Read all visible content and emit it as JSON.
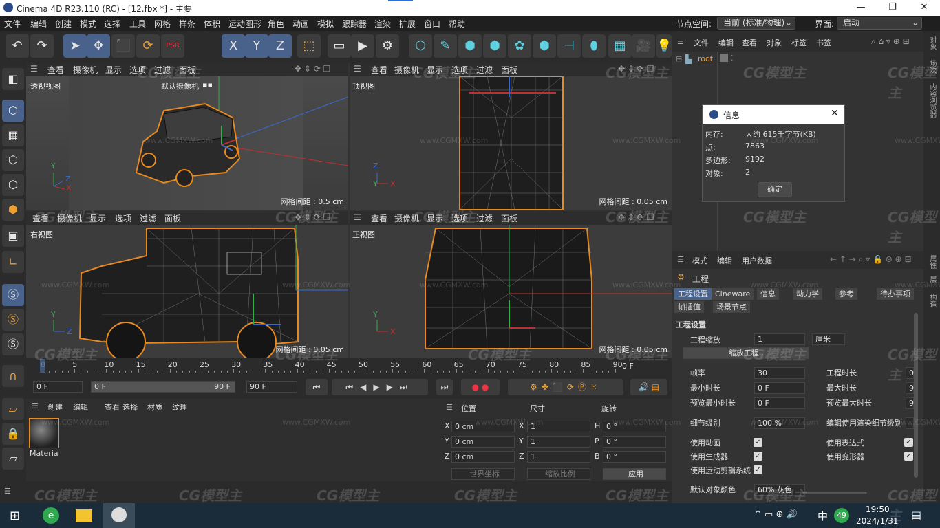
{
  "window": {
    "title": "Cinema 4D R23.110 (RC) - [12.fbx *] - 主要",
    "min": "—",
    "max": "❐",
    "close": "✕"
  },
  "menu": {
    "items": [
      "文件",
      "编辑",
      "创建",
      "模式",
      "选择",
      "工具",
      "网格",
      "样条",
      "体积",
      "运动图形",
      "角色",
      "动画",
      "模拟",
      "跟踪器",
      "渲染",
      "扩展",
      "窗口",
      "帮助"
    ],
    "node_space_label": "节点空间:",
    "node_space_value": "当前 (标准/物理)",
    "layout_label": "界面:",
    "layout_value": "启动"
  },
  "toolbar": {
    "icons": [
      "undo-icon",
      "redo-icon",
      "select-icon",
      "move-icon",
      "scale-icon",
      "rotate-icon",
      "psr-icon",
      "recent-tool-icon",
      "x-axis-icon",
      "y-axis-icon",
      "z-axis-icon",
      "coordinate-system-icon",
      "render-region-icon",
      "render-view-icon",
      "render-settings-icon",
      "cube-icon",
      "pen-icon",
      "subdivision-icon",
      "extrude-icon",
      "cloner-icon",
      "array-icon",
      "deformer-icon",
      "field-icon",
      "floor-icon",
      "camera-icon",
      "light-icon"
    ],
    "glyphs": [
      "↶",
      "↷",
      "➤",
      "✥",
      "⬛",
      "⟳",
      "PSR",
      "↺",
      "X",
      "Y",
      "Z",
      "⬚",
      "▭",
      "▶",
      "⚙",
      "⬡",
      "✎",
      "⬢",
      "⬢",
      "✿",
      "⬢",
      "⊣",
      "⬮",
      "▦",
      "🎥",
      "💡"
    ]
  },
  "viewports": [
    {
      "menu": [
        "查看",
        "摄像机",
        "显示",
        "选项",
        "过滤",
        "面板"
      ],
      "name": "透视视图",
      "camera": "默认摄像机",
      "grid": "网格间距 : 0.5 cm"
    },
    {
      "menu": [
        "查看",
        "摄像机",
        "显示",
        "选项",
        "过滤",
        "面板"
      ],
      "name": "顶视图",
      "grid": "网格间距 : 0.05 cm"
    },
    {
      "menu": [
        "查看",
        "摄像机",
        "显示",
        "选项",
        "过滤",
        "面板"
      ],
      "name": "右视图",
      "grid": "网格间距 : 0.05 cm"
    },
    {
      "menu": [
        "查看",
        "摄像机",
        "显示",
        "选项",
        "过滤",
        "面板"
      ],
      "name": "正视图",
      "grid": "网格间距 : 0.05 cm"
    }
  ],
  "axis": {
    "x": "X",
    "y": "Y",
    "z": "Z"
  },
  "timeline": {
    "ticks": [
      "0",
      "5",
      "10",
      "15",
      "20",
      "25",
      "30",
      "35",
      "40",
      "45",
      "50",
      "55",
      "60",
      "65",
      "70",
      "75",
      "80",
      "85",
      "90"
    ],
    "end_frame": "0 F",
    "current": "0 F",
    "range_start": "0 F",
    "range_end": "90 F",
    "max": "90 F"
  },
  "materials": {
    "menu": [
      "创建",
      "编辑",
      "查看",
      "选择",
      "材质",
      "纹理"
    ],
    "item": "Materia"
  },
  "coords": {
    "headers": [
      "位置",
      "尺寸",
      "旋转"
    ],
    "rows": [
      [
        "X",
        "0 cm",
        "X",
        "1",
        "H",
        "0 °"
      ],
      [
        "Y",
        "0 cm",
        "Y",
        "1",
        "P",
        "0 °"
      ],
      [
        "Z",
        "0 cm",
        "Z",
        "1",
        "B",
        "0 °"
      ]
    ],
    "world": "世界坐标",
    "scale": "缩放比例",
    "apply": "应用"
  },
  "objects": {
    "menu": [
      "文件",
      "编辑",
      "查看",
      "对象",
      "标签",
      "书签"
    ],
    "root": "root"
  },
  "info_dialog": {
    "title": "信息",
    "rows": [
      [
        "内存:",
        "大约 615千字节(KB)"
      ],
      [
        "点:",
        "7863"
      ],
      [
        "多边形:",
        "9192"
      ],
      [
        "对象:",
        "2"
      ]
    ],
    "ok": "确定",
    "close": "✕"
  },
  "attributes": {
    "menu": [
      "模式",
      "编辑",
      "用户数据"
    ],
    "title": "工程",
    "tabs": [
      "工程设置",
      "Cineware",
      "信息",
      "动力学",
      "参考",
      "待办事项"
    ],
    "tabs2": [
      "帧插值",
      "场景节点"
    ],
    "section": "工程设置",
    "scale_label": "工程缩放",
    "scale_value": "1",
    "scale_unit": "厘米",
    "scale_btn": "缩放工程...",
    "left": [
      [
        "帧率",
        "30"
      ],
      [
        "最小时长",
        "0 F"
      ],
      [
        "预览最小时长",
        "0 F"
      ],
      [
        "细节级别",
        "100 %"
      ]
    ],
    "right": [
      [
        "工程时长",
        "0"
      ],
      [
        "最大时长",
        "9"
      ],
      [
        "预览最大时长",
        "9"
      ],
      [
        "编辑使用渲染细节级别",
        ""
      ]
    ],
    "checks_left": [
      "使用动画",
      "使用生成器",
      "使用运动剪辑系统"
    ],
    "checks_right": [
      "使用表达式",
      "使用变形器"
    ],
    "default_color": "默认对象颜色",
    "default_color_value": "60% 灰色"
  },
  "right_strip": [
    "对象",
    "场次",
    "内容浏览器",
    "属性",
    "层",
    "构造"
  ],
  "taskbar": {
    "time": "19:50",
    "date": "2024/1/31",
    "ime": "中",
    "badge": "49"
  },
  "watermark": {
    "text": "CG模型主",
    "url": "www.CGMXW.com"
  }
}
